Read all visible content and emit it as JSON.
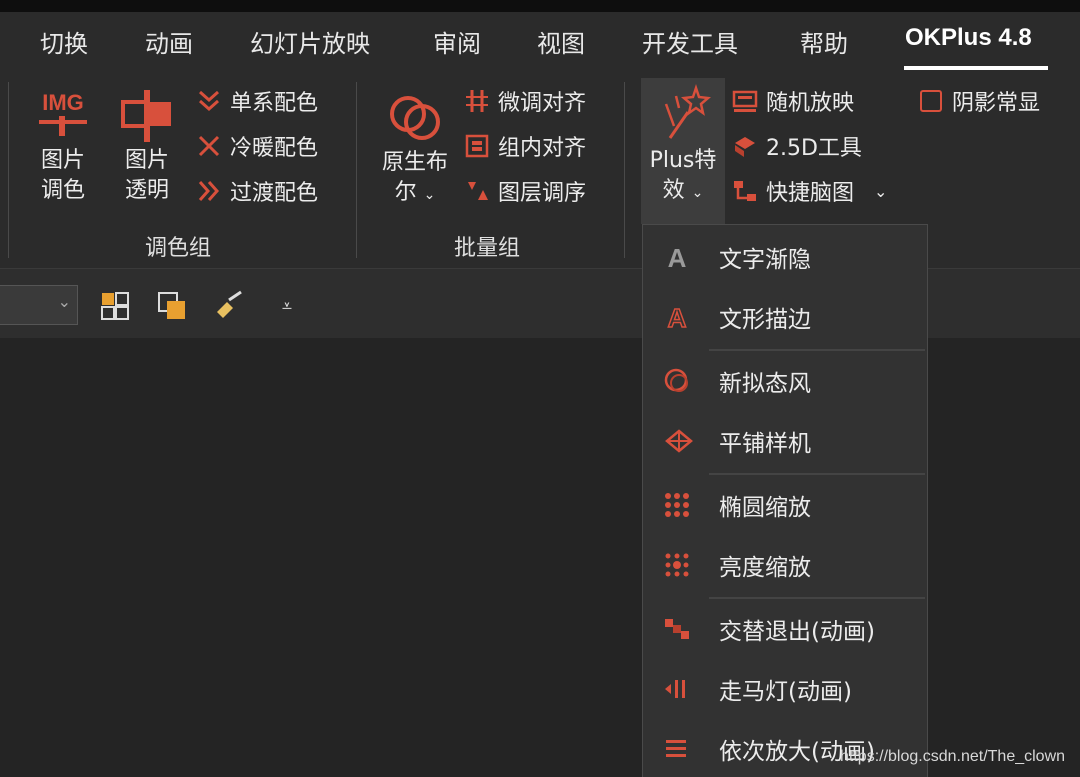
{
  "colors": {
    "accent": "#d8503c",
    "text": "#ececec",
    "background": "#262626",
    "ribbon": "#2b2b2b"
  },
  "tabs": [
    {
      "label": "切换"
    },
    {
      "label": "动画"
    },
    {
      "label": "幻灯片放映"
    },
    {
      "label": "审阅"
    },
    {
      "label": "视图"
    },
    {
      "label": "开发工具"
    },
    {
      "label": "帮助"
    },
    {
      "label": "OKPlus 4.8"
    }
  ],
  "ribbon": {
    "color_group": {
      "label": "调色组",
      "img_adjust": {
        "icon_text": "IMG",
        "line1": "图片",
        "line2": "调色"
      },
      "img_transparent": {
        "line1": "图片",
        "line2": "透明"
      },
      "single_color": "单系配色",
      "warm_cool": "冷暖配色",
      "transition_color": "过渡配色"
    },
    "batch_group": {
      "label": "批量组",
      "native_boolean": {
        "line1": "原生布",
        "line2": "尔"
      },
      "fine_align": "微调对齐",
      "group_align": "组内对齐",
      "layer_order": "图层调序"
    },
    "plus_group": {
      "plus_effects": {
        "line1": "Plus特",
        "line2": "效"
      },
      "random_show": "随机放映",
      "tool_25d": "2.5D工具",
      "quick_mindmap": "快捷脑图",
      "shadow_always": "阴影常显"
    }
  },
  "menu": {
    "items": [
      {
        "label": "文字渐隐",
        "icon": "text-fade-icon"
      },
      {
        "label": "文形描边",
        "icon": "text-outline-icon"
      },
      {
        "label": "新拟态风",
        "icon": "neumorphism-icon"
      },
      {
        "label": "平铺样机",
        "icon": "tile-mockup-icon"
      },
      {
        "label": "椭圆缩放",
        "icon": "ellipse-zoom-icon"
      },
      {
        "label": "亮度缩放",
        "icon": "brightness-zoom-icon"
      },
      {
        "label": "交替退出(动画)",
        "icon": "alternate-exit-icon"
      },
      {
        "label": "走马灯(动画)",
        "icon": "marquee-icon"
      },
      {
        "label": "依次放大(动画)",
        "icon": "sequential-zoom-icon"
      }
    ]
  },
  "watermark": "https://blog.csdn.net/The_clown"
}
